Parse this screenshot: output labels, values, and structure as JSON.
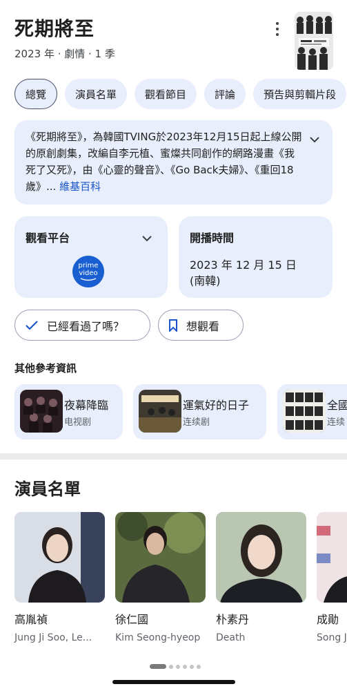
{
  "header": {
    "title": "死期將至",
    "subtitle": "2023 年 · 劇情 · 1 季"
  },
  "tabs": [
    {
      "label": "總覽"
    },
    {
      "label": "演員名單"
    },
    {
      "label": "觀看節目"
    },
    {
      "label": "評論"
    },
    {
      "label": "預告與剪輯片段"
    }
  ],
  "summary": {
    "text": "《死期將至》，為韓國TVING於2023年12月15日起上線公開的原創劇集，改編自李元植、蜜燦共同創作的網路漫畫《我死了又死》，由《心靈的聲音》、《Go Back夫婦》、《重回18歲》...",
    "source_link": "維基百科"
  },
  "watch_card": {
    "title": "觀看平台",
    "provider_logo_text": "prime video"
  },
  "premiere_card": {
    "title": "開播時間",
    "date": "2023 年 12 月 15 日",
    "region": "(南韓)"
  },
  "actions": {
    "watched_label": "已經看過了嗎？",
    "watchlist_label": "想觀看"
  },
  "related": {
    "heading": "其他參考資訊",
    "items": [
      {
        "title": "夜幕降臨",
        "type": "电视剧"
      },
      {
        "title": "運氣好的日子",
        "type": "连续剧"
      },
      {
        "title": "全國",
        "type": "连续"
      }
    ]
  },
  "cast": {
    "heading": "演員名單",
    "members": [
      {
        "name": "高胤禎",
        "role": "Jung Ji Soo, Le..."
      },
      {
        "name": "徐仁國",
        "role": "Kim Seong-hyeop"
      },
      {
        "name": "朴素丹",
        "role": "Death"
      },
      {
        "name": "成勛",
        "role": "Song J"
      }
    ]
  },
  "colors": {
    "chip_bg": "#e8eefb",
    "link": "#1a56c9",
    "prime_blue": "#1a5fd1"
  }
}
